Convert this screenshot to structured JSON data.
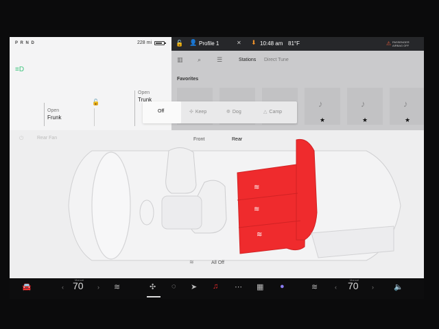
{
  "status": {
    "gears": "P R N D",
    "range": "228 mi",
    "battery_level": 0.8,
    "headlight_icon": "headlight-icon"
  },
  "top_bar": {
    "profile": "Profile 1",
    "time": "10:48 am",
    "temperature": "81°F",
    "airbag_line1": "PASSENGER",
    "airbag_line2": "AIRBAG OFF"
  },
  "car_panel": {
    "frunk_open_label": "Open",
    "frunk_label": "Frunk",
    "trunk_open_label": "Open",
    "trunk_label": "Trunk"
  },
  "media": {
    "tabs": [
      "Stations",
      "Direct Tune"
    ],
    "favorites_title": "Favorites",
    "favorites_count": 6
  },
  "seat_popup": {
    "options": [
      "Off",
      "Keep",
      "Dog",
      "Camp"
    ],
    "selected": "Off"
  },
  "climate": {
    "rear_fan": "Rear Fan",
    "tabs": [
      "Front",
      "Rear"
    ],
    "selected_tab": "Rear",
    "all_off": "All Off",
    "accent_color": "#ef2b2d",
    "rear_seat_heat_level": 3
  },
  "dock": {
    "left_mode": "Manual",
    "left_temp": "70",
    "right_mode": "Manual",
    "right_temp": "70"
  }
}
